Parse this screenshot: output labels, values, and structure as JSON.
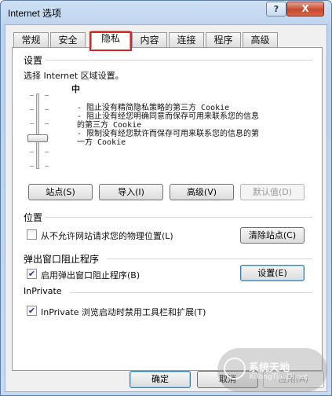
{
  "window": {
    "title": "Internet 选项",
    "help_glyph": "?",
    "close_glyph": "X"
  },
  "tabs": [
    {
      "label": "常规"
    },
    {
      "label": "安全"
    },
    {
      "label": "隐私",
      "active": true
    },
    {
      "label": "内容"
    },
    {
      "label": "连接"
    },
    {
      "label": "程序"
    },
    {
      "label": "高级"
    }
  ],
  "settings": {
    "heading": "设置",
    "instruction": "选择 Internet 区域设置。",
    "level": "中",
    "desc_line1": "- 阻止没有精简隐私策略的第三方 Cookie",
    "desc_line2": "- 阻止没有经您明确同意而保存可用来联系您的信息",
    "desc_line3": "的第三方 Cookie",
    "desc_line4": "- 限制没有经您默许而保存可用来联系您的信息的第",
    "desc_line5": "一方 Cookie",
    "slider_level": "3/6",
    "buttons": {
      "sites": "站点(S)",
      "import": "导入(I)",
      "advanced": "高级(V)",
      "default": "默认值(D)"
    }
  },
  "location": {
    "heading": "位置",
    "checkbox_label": "从不允许网站请求您的物理位置(L)",
    "checked": false,
    "clear_sites": "清除站点(C)"
  },
  "popup": {
    "heading": "弹出窗口阻止程序",
    "checkbox_label": "启用弹出窗口阻止程序(B)",
    "checked": true,
    "settings_button": "设置(E)"
  },
  "inprivate": {
    "heading": "InPrivate",
    "checkbox_label": "InPrivate 浏览启动时禁用工具栏和扩展(T)",
    "checked": true
  },
  "footer": {
    "ok": "确定",
    "cancel": "取消",
    "apply": "应用(A)"
  },
  "watermark": {
    "text": "系统天地",
    "subtext": "XiTongTianDi.net"
  }
}
